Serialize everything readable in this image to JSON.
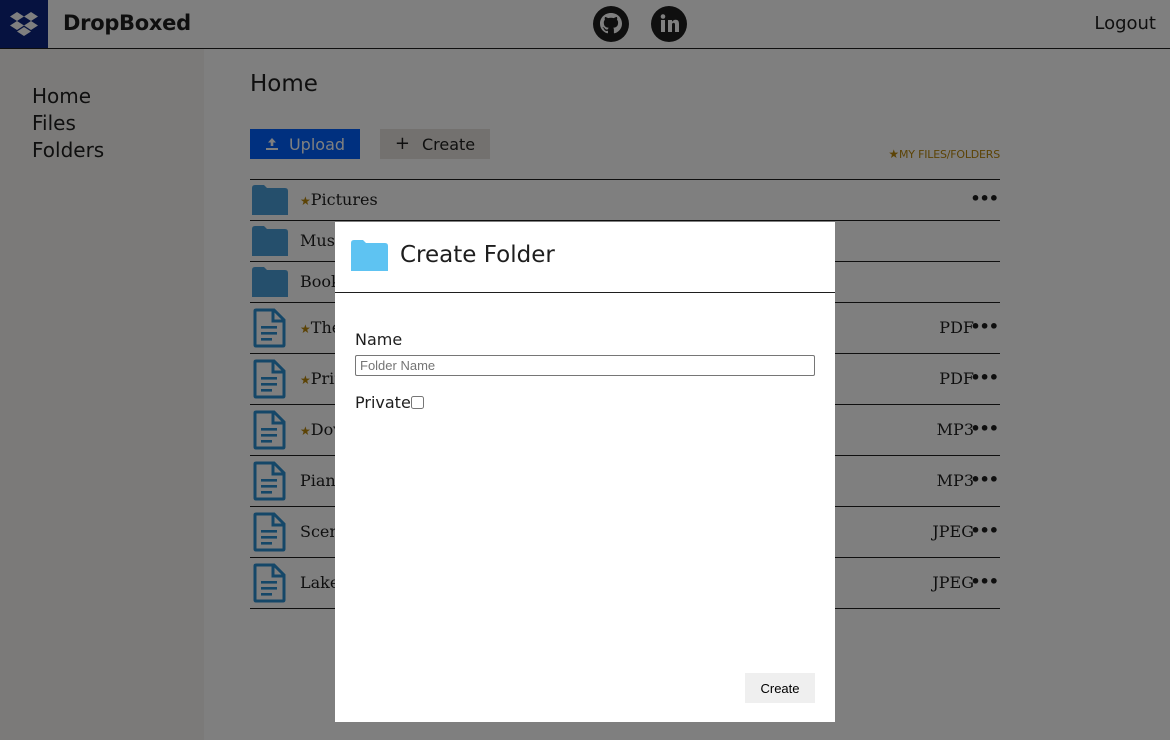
{
  "header": {
    "brand": "DropBoxed",
    "logout_label": "Logout",
    "icons": [
      "dropbox-logo-icon",
      "github-icon",
      "linkedin-icon"
    ]
  },
  "sidebar": {
    "items": [
      {
        "label": "Home"
      },
      {
        "label": "Files"
      },
      {
        "label": "Folders"
      }
    ]
  },
  "main": {
    "title": "Home",
    "upload_label": "Upload",
    "create_label": "Create",
    "my_files_label": "MY FILES/FOLDERS",
    "rows": [
      {
        "kind": "folder",
        "name": "Pictures",
        "starred": true,
        "type": ""
      },
      {
        "kind": "folder",
        "name": "Music",
        "starred": false,
        "type": ""
      },
      {
        "kind": "folder",
        "name": "Book",
        "starred": false,
        "type": ""
      },
      {
        "kind": "file",
        "name": "The",
        "starred": true,
        "type": "PDF"
      },
      {
        "kind": "file",
        "name": "Prir",
        "starred": true,
        "type": "PDF"
      },
      {
        "kind": "file",
        "name": "Dov",
        "starred": true,
        "type": "MP3"
      },
      {
        "kind": "file",
        "name": "Piano",
        "starred": false,
        "type": "MP3"
      },
      {
        "kind": "file",
        "name": "Scene",
        "starred": false,
        "type": "JPEG"
      },
      {
        "kind": "file",
        "name": "Lake",
        "starred": false,
        "type": "JPEG"
      }
    ]
  },
  "modal": {
    "title": "Create Folder",
    "name_label": "Name",
    "name_placeholder": "Folder Name",
    "name_value": "",
    "private_label": "Private",
    "private_checked": false,
    "create_button": "Create"
  },
  "colors": {
    "brand_dark": "#0d2481",
    "upload_blue": "#0061fe",
    "folder_blue": "#4a9fd8",
    "star_gold": "#b8860b",
    "sidebar_bg": "#f7f5f2"
  }
}
